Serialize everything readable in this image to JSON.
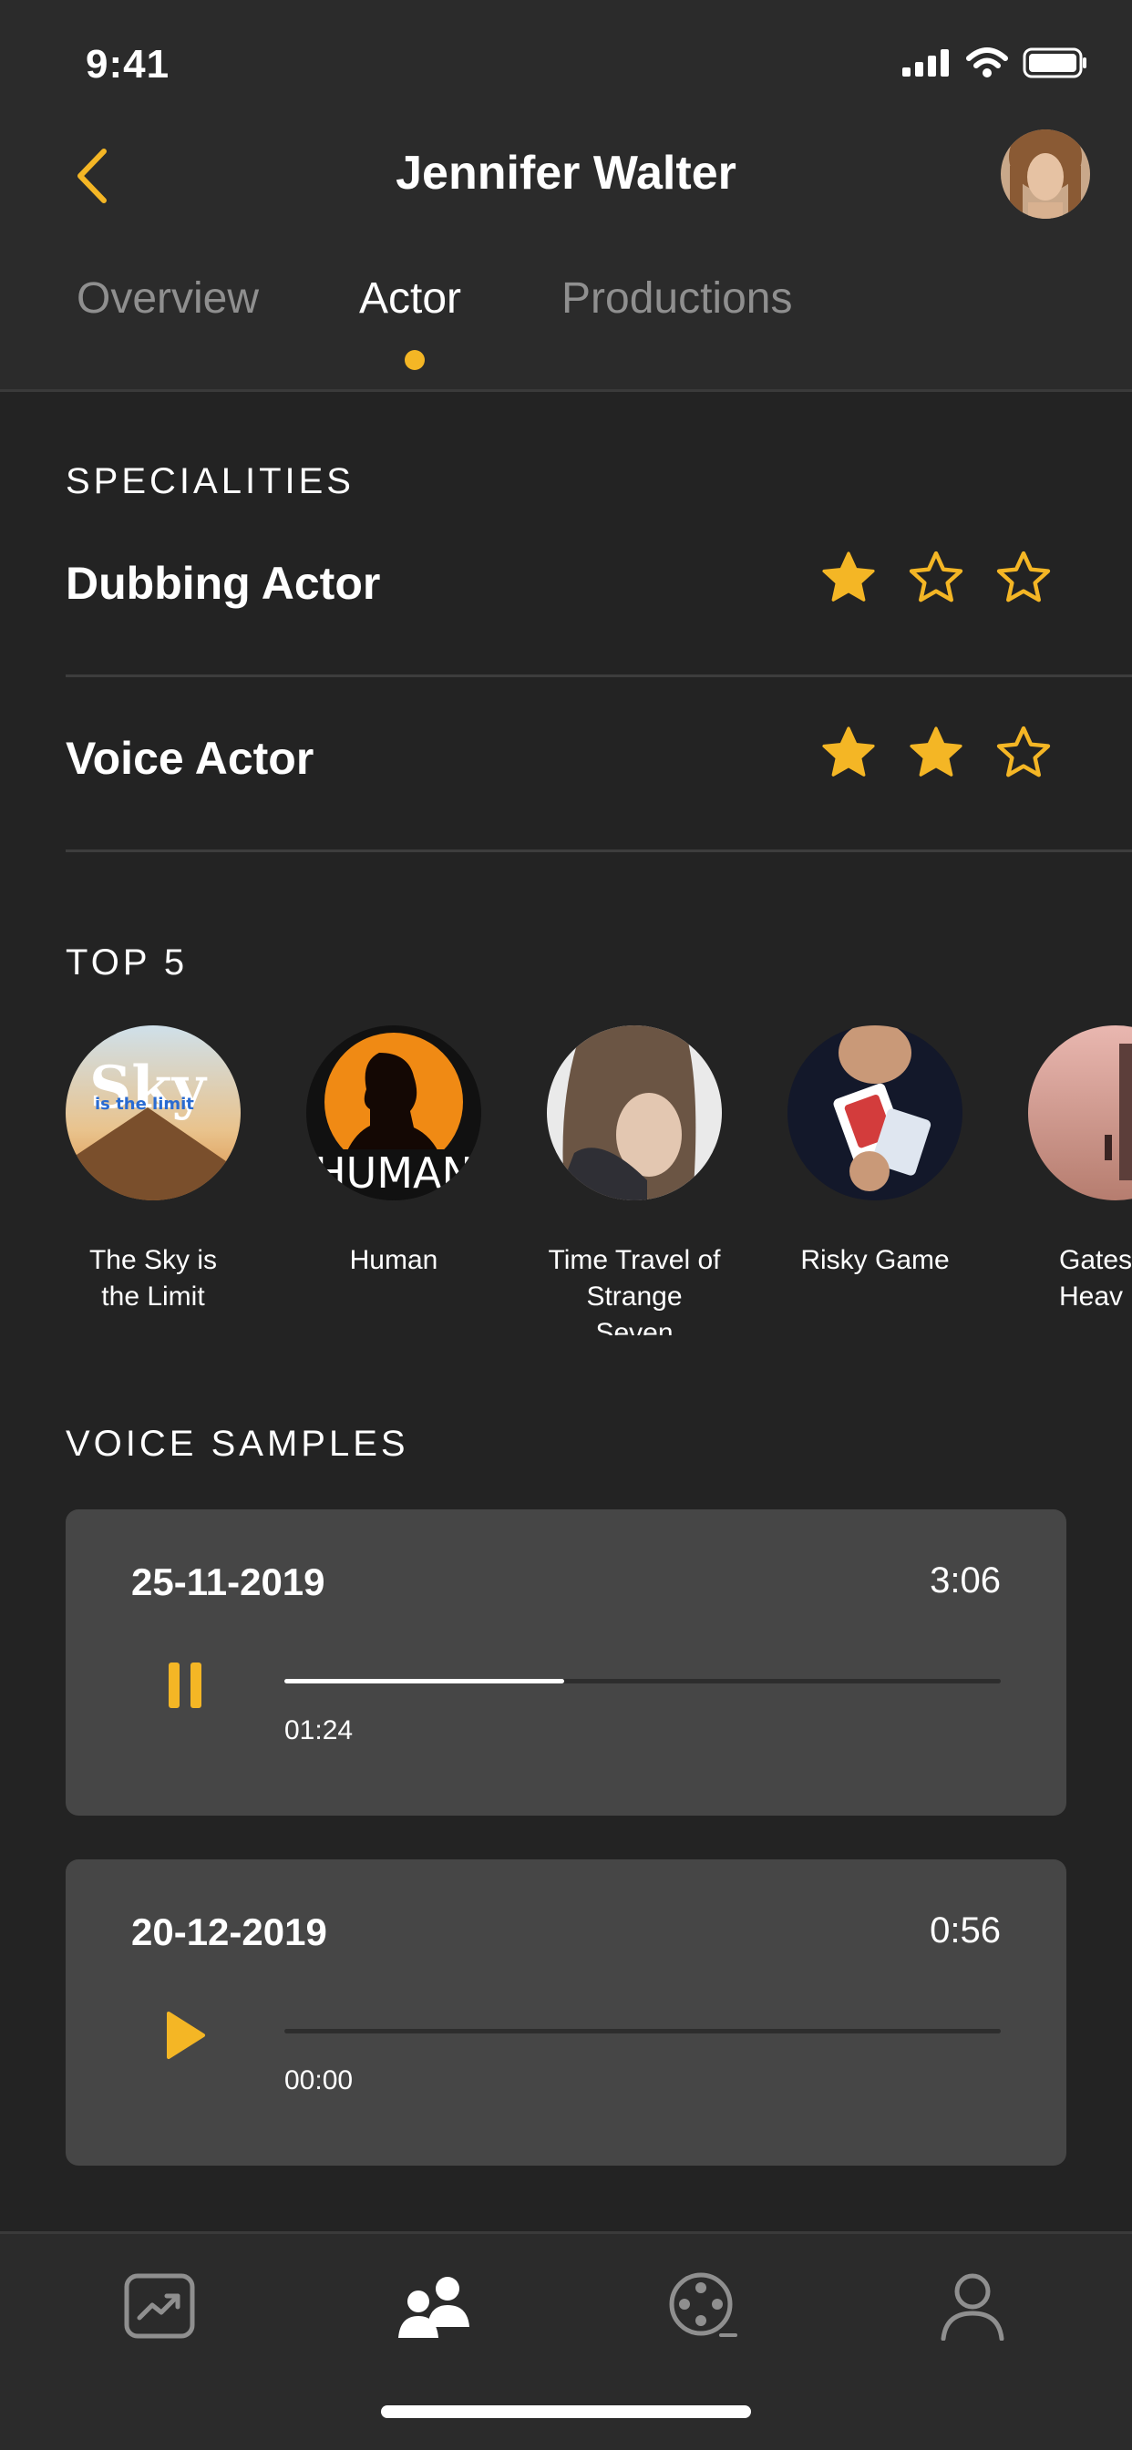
{
  "status_bar": {
    "time": "9:41"
  },
  "header": {
    "title": "Jennifer Walter"
  },
  "tabs": [
    {
      "label": "Overview",
      "active": false
    },
    {
      "label": "Actor",
      "active": true
    },
    {
      "label": "Productions",
      "active": false
    }
  ],
  "specialities": {
    "title": "SPECIALITIES",
    "items": [
      {
        "name": "Dubbing Actor",
        "rating": 1,
        "max": 3
      },
      {
        "name": "Voice Actor",
        "rating": 2,
        "max": 3
      }
    ]
  },
  "top5": {
    "title": "TOP 5",
    "items": [
      {
        "title": "The Sky is the Limit",
        "line1": "The Sky is",
        "line2": "the Limit",
        "poster_text": "is the limit"
      },
      {
        "title": "Human",
        "line1": "Human",
        "line2": "",
        "poster_text": "HUMAN"
      },
      {
        "title": "Time Travel of Strange Seven",
        "line1": "Time Travel of",
        "line2": "Strange Seven"
      },
      {
        "title": "Risky Game",
        "line1": "Risky Game",
        "line2": ""
      },
      {
        "title": "Gates of Heaven",
        "line1": "Gates",
        "line2": "Heav"
      }
    ]
  },
  "voice_samples": {
    "title": "VOICE SAMPLES",
    "items": [
      {
        "date": "25-11-2019",
        "duration": "3:06",
        "position": "01:24",
        "progress": 0.39,
        "state": "playing"
      },
      {
        "date": "20-12-2019",
        "duration": "0:56",
        "position": "00:00",
        "progress": 0,
        "state": "paused"
      }
    ]
  },
  "colors": {
    "accent": "#f4b625",
    "background": "#232323",
    "header_bg": "#2b2b2b",
    "card_bg": "#464646"
  },
  "tabbar": {
    "icons": [
      "chart-icon",
      "people-icon",
      "film-reel-icon",
      "profile-icon"
    ],
    "active_index": 1
  }
}
